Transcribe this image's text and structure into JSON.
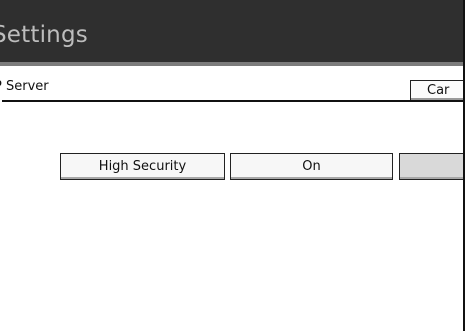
{
  "window": {
    "title": "Settings"
  },
  "path": {
    "label": "P Server"
  },
  "toolbar": {
    "cancel_label": "Car"
  },
  "options": {
    "high_security_label": "High Security",
    "on_label": "On",
    "third_label": ""
  },
  "colors": {
    "titlebar_bg": "#2f2f2f",
    "title_text": "#bdbdbd",
    "button_bg": "#f7f7f7",
    "selected_button_bg": "#d9d9d9",
    "border": "#111111"
  }
}
